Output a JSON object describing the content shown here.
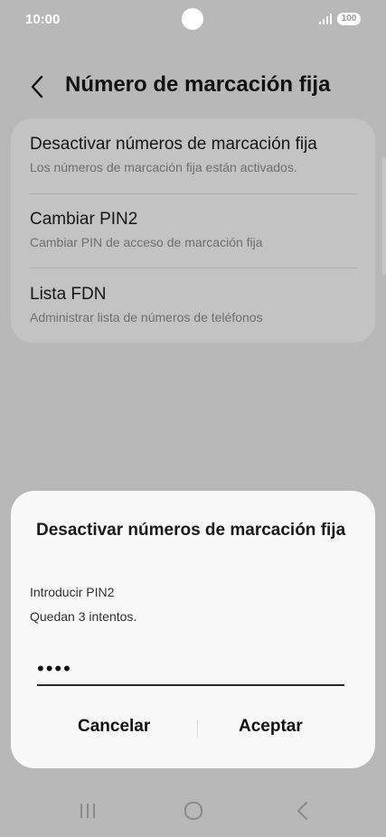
{
  "status_bar": {
    "time": "10:00",
    "battery": "100"
  },
  "header": {
    "back_icon": "chevron-left-icon",
    "title": "Número de marcación fija"
  },
  "settings": {
    "items": [
      {
        "title": "Desactivar números de marcación fija",
        "subtitle": "Los números de marcación fija están activados."
      },
      {
        "title": "Cambiar PIN2",
        "subtitle": "Cambiar PIN de acceso de marcación fija"
      },
      {
        "title": "Lista FDN",
        "subtitle": "Administrar lista de números de teléfonos"
      }
    ]
  },
  "dialog": {
    "title": "Desactivar números de marcación fija",
    "prompt": "Introducir PIN2",
    "attempts": "Quedan 3 intentos.",
    "pin_value": "••••",
    "cancel_label": "Cancelar",
    "accept_label": "Aceptar"
  },
  "nav_bar": {
    "icons": [
      "recent-apps-icon",
      "home-icon",
      "back-icon"
    ]
  },
  "colors": {
    "background": "#b8b8b8",
    "card": "#c3c3c3",
    "dialog": "#f8f8f8"
  }
}
